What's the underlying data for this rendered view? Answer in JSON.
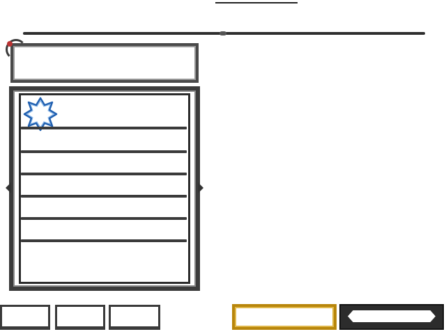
{
  "header": {
    "title": ""
  },
  "title_panel": {
    "text": ""
  },
  "list": {
    "badge_icon": "eight-point-star-icon",
    "slots": [
      "",
      "",
      "",
      "",
      "",
      ""
    ]
  },
  "bottom_tabs": [
    {
      "label": ""
    },
    {
      "label": ""
    },
    {
      "label": ""
    }
  ],
  "buttons": {
    "primary_label": "",
    "secondary_label": ""
  },
  "colors": {
    "frame": "#3b3b3b",
    "primary_border": "#b8860b",
    "star_outline": "#1f5fb0",
    "star_fill": "#ffffff"
  }
}
